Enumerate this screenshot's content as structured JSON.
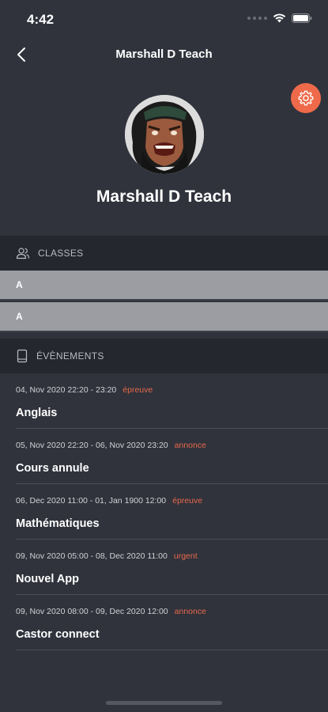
{
  "status_bar": {
    "time": "4:42",
    "icons": [
      "cellular-dots-icon",
      "wifi-icon",
      "battery-icon"
    ]
  },
  "nav": {
    "title": "Marshall D Teach",
    "back_icon": "chevron-left-icon"
  },
  "settings": {
    "icon": "gear-icon",
    "color": "#ee6a4a"
  },
  "profile": {
    "name": "Marshall D Teach",
    "avatar_icon": "profile-avatar"
  },
  "classes": {
    "header": "CLASSES",
    "icon": "users-icon",
    "items": [
      {
        "label": "A"
      },
      {
        "label": "A"
      }
    ]
  },
  "events": {
    "header": "ÉVÈNEMENTS",
    "icon": "book-icon",
    "tag_color": "#e8684a",
    "items": [
      {
        "date": "04, Nov 2020 22:20 - 23:20",
        "tag": "épreuve",
        "title": "Anglais"
      },
      {
        "date": "05, Nov 2020 22:20 - 06, Nov 2020 23:20",
        "tag": "annonce",
        "title": "Cours annule"
      },
      {
        "date": "06, Dec 2020 11:00 - 01, Jan 1900 12:00",
        "tag": "épreuve",
        "title": "Mathématiques"
      },
      {
        "date": "09, Nov 2020 05:00 - 08, Dec 2020 11:00",
        "tag": "urgent",
        "title": "Nouvel App"
      },
      {
        "date": "09, Nov 2020 08:00 - 09, Dec 2020 12:00",
        "tag": "annonce",
        "title": "Castor connect"
      }
    ]
  },
  "theme": {
    "background": "#30333c",
    "section_header_bg": "#24272e",
    "class_row_bg": "#9b9da3"
  }
}
